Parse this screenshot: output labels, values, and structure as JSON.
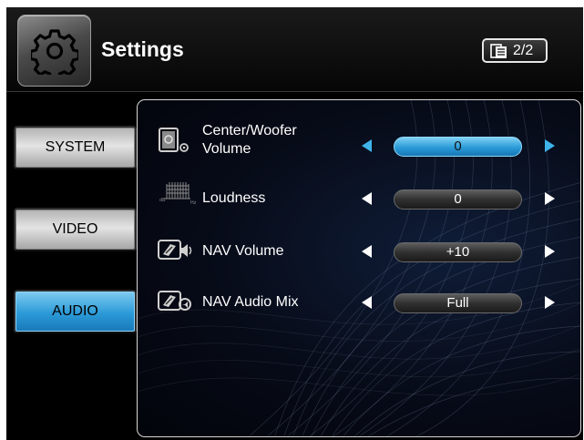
{
  "header": {
    "title": "Settings",
    "icon": "gear-icon",
    "page_indicator": "2/2",
    "page_icon": "page-list-icon"
  },
  "sidebar": {
    "items": [
      {
        "label": "SYSTEM",
        "active": false
      },
      {
        "label": "VIDEO",
        "active": false
      },
      {
        "label": "AUDIO",
        "active": true
      }
    ]
  },
  "settings": {
    "rows": [
      {
        "label_line1": "Center/Woofer",
        "label_line2": "Volume",
        "value": "0",
        "icon": "speaker-icon",
        "active": true
      },
      {
        "label": "Loudness",
        "value": "0",
        "icon": "loudness-icon",
        "active": false
      },
      {
        "label": "NAV Volume",
        "value": "+10",
        "icon": "nav-volume-icon",
        "active": false
      },
      {
        "label": "NAV Audio Mix",
        "value": "Full",
        "icon": "nav-audio-mix-icon",
        "active": false
      }
    ]
  },
  "colors": {
    "accent": "#2a9bd8",
    "arrow_active": "#3fb4ea",
    "background": "#000000"
  }
}
